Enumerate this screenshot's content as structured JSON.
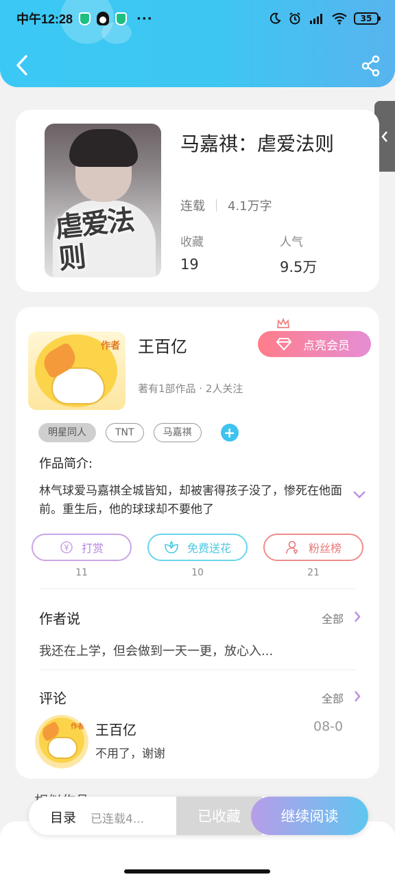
{
  "status_bar": {
    "time": "中午12:28",
    "more": "···",
    "battery": "35"
  },
  "header": {
    "back_icon": "chevron-left-icon",
    "share_icon": "share-icon"
  },
  "side_tab": {
    "icon": "chevron-left-icon"
  },
  "book": {
    "cover_title": "虐爱法则",
    "title": "马嘉祺：虐爱法则",
    "status": "连载",
    "word_count": "4.1万字",
    "favorites_label": "收藏",
    "favorites_value": "19",
    "popularity_label": "人气",
    "popularity_value": "9.5万"
  },
  "author": {
    "avatar_tag": "作者",
    "name": "王百亿",
    "vip_label": "点亮会员",
    "meta": "著有1部作品 · 2人关注",
    "tags": [
      "明星同人",
      "TNT",
      "马嘉祺"
    ]
  },
  "intro": {
    "label": "作品简介:",
    "text": "林气球爱马嘉祺全城皆知，却被害得孩子没了，惨死在他面前。重生后，他的球球却不要他了"
  },
  "actions": [
    {
      "label": "打赏",
      "count": "11",
      "icon": "yen-icon"
    },
    {
      "label": "免费送花",
      "count": "10",
      "icon": "flower-icon"
    },
    {
      "label": "粉丝榜",
      "count": "21",
      "icon": "user-icon"
    }
  ],
  "author_says": {
    "title": "作者说",
    "all": "全部",
    "text": "我还在上学，但会做到一天一更，放心入..."
  },
  "comments": {
    "title": "评论",
    "all": "全部",
    "item": {
      "avatar_tag": "作者",
      "name": "王百亿",
      "date": "08-0",
      "text": "不用了，谢谢"
    }
  },
  "similar": {
    "title": "相似作品"
  },
  "bottom_bar": {
    "toc": "目录",
    "progress": "已连载4...",
    "favorited": "已收藏",
    "continue": "继续阅读"
  },
  "colors": {
    "header_blue": "#3ec6f2",
    "vip_pink": "#ff7d8a",
    "read_purple": "#b79de8"
  }
}
